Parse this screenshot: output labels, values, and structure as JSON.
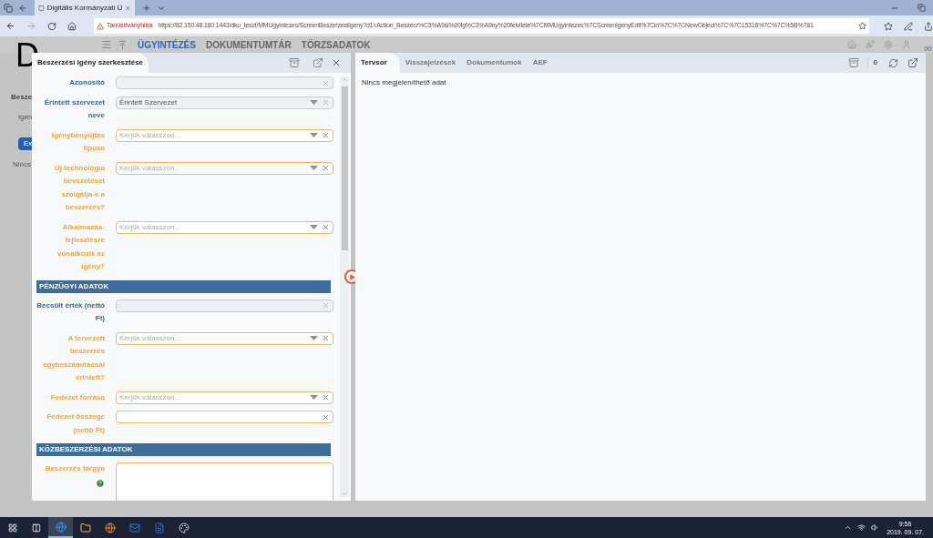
{
  "browser": {
    "tab_title": "Digitális Kormányzati Ü",
    "security_warning": "Tanúsítványhiba",
    "url": "https://82.150.48.180:1443/dku_teszt/MMUgyintezes/ScreenBeszerzesiIgeny?d1=Action_Beszerz%C3%A9si%20ig%C3%A9ny%20felvitele%7CMMUgyintezes%7CScreenIgenyEdit%7Cin%7C%7CNewObject%7C%7C15316%7C%7C%5B%781"
  },
  "app": {
    "logo": "D",
    "nav": [
      {
        "label": "ÜGYINTÉZÉS",
        "selected": true
      },
      {
        "label": "DOKUMENTUMTÁR",
        "selected": false
      },
      {
        "label": "TÖRZSADATOK",
        "selected": false
      }
    ],
    "background": {
      "heading": "Besze",
      "field_label": "Igén",
      "button": "Ex",
      "empty_text": "Nincs",
      "corner_text": "00:"
    }
  },
  "edit_dialog": {
    "title": "Beszerzési igény szerkesztése",
    "rows": [
      {
        "kind": "text",
        "label": "Azonosító",
        "required": false,
        "readonly": true
      },
      {
        "kind": "select",
        "label": "Érintett szervezet neve",
        "value": "Érintett Szervezet",
        "required": false,
        "readonly": true
      },
      {
        "kind": "select",
        "label": "Igénybenyújtás típusa",
        "placeholder": "Kérjük válasszon...",
        "required": true,
        "readonly": false
      },
      {
        "kind": "select",
        "label": "Új technológia bevezetését szolgálja-e a beszerzés?",
        "placeholder": "Kérjük válasszon...",
        "required": true,
        "readonly": false
      },
      {
        "kind": "select",
        "label": "Alkalmazás-fejlesztésre vonatkozik az igény?",
        "placeholder": "Kérjük válasszon...",
        "required": true,
        "readonly": false
      },
      {
        "kind": "section",
        "label": "PÉNZÜGYI ADATOK"
      },
      {
        "kind": "text",
        "label": "Becsült érték (nettó Ft)",
        "required": false,
        "readonly": true
      },
      {
        "kind": "select",
        "label": "A tervezett beszerzés egybeszámítással érintett?",
        "placeholder": "Kérjük válasszon...",
        "required": true,
        "readonly": false
      },
      {
        "kind": "select",
        "label": "Fedezet forrása",
        "placeholder": "Kérjük válasszon...",
        "required": true,
        "readonly": false
      },
      {
        "kind": "text",
        "label": "Fedezet összege (nettó Ft)",
        "required": true,
        "readonly": false
      },
      {
        "kind": "section",
        "label": "KÖZBESZERZÉSI ADATOK"
      },
      {
        "kind": "textarea",
        "label": "Beszerzés tárgya",
        "required": true,
        "readonly": false,
        "help": true
      }
    ]
  },
  "tabs_dialog": {
    "tabs": [
      {
        "label": "Tervsor",
        "selected": true
      },
      {
        "label": "Visszajelzések",
        "selected": false
      },
      {
        "label": "Dokumentumok",
        "selected": false
      },
      {
        "label": "ÁEF",
        "selected": false
      }
    ],
    "count": "0",
    "empty_text": "Nincs megjeleníthető adat"
  },
  "taskbar": {
    "time": "9:56",
    "date": "2019. 09. 07."
  }
}
